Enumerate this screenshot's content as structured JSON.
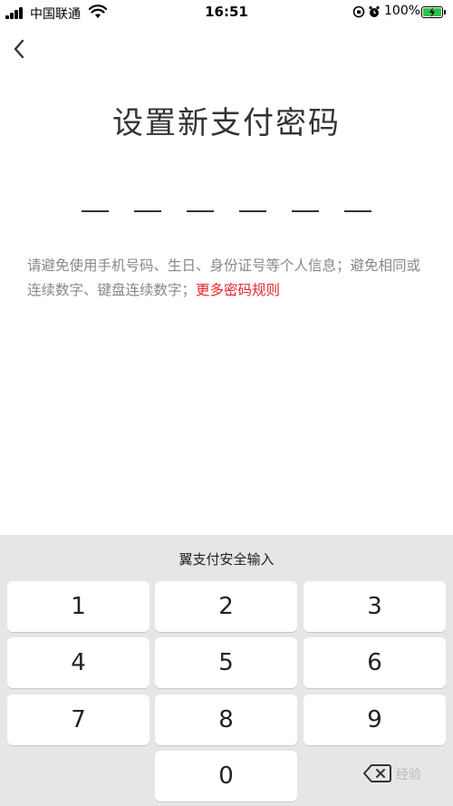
{
  "status_bar": {
    "carrier": "中国联通",
    "time": "16:51",
    "battery_percent": "100%",
    "battery_level": 1.0,
    "battery_color": "#2ec24c",
    "icons": [
      "signal-icon",
      "wifi-icon",
      "rotation-lock-icon",
      "alarm-icon",
      "battery-charging-icon"
    ]
  },
  "nav": {
    "back_icon": "chevron-left-icon"
  },
  "title": "设置新支付密码",
  "pin": {
    "length": 6,
    "entered": 0
  },
  "hint": {
    "text": "请避免使用手机号码、生日、身份证号等个人信息；避免相同或连续数字、键盘连续数字；",
    "link": "更多密码规则",
    "link_color": "#e8262d"
  },
  "keyboard": {
    "title": "翼支付安全输入",
    "keys": [
      "1",
      "2",
      "3",
      "4",
      "5",
      "6",
      "7",
      "8",
      "9",
      "0"
    ],
    "delete_icon": "backspace-icon",
    "watermark": "经验"
  }
}
